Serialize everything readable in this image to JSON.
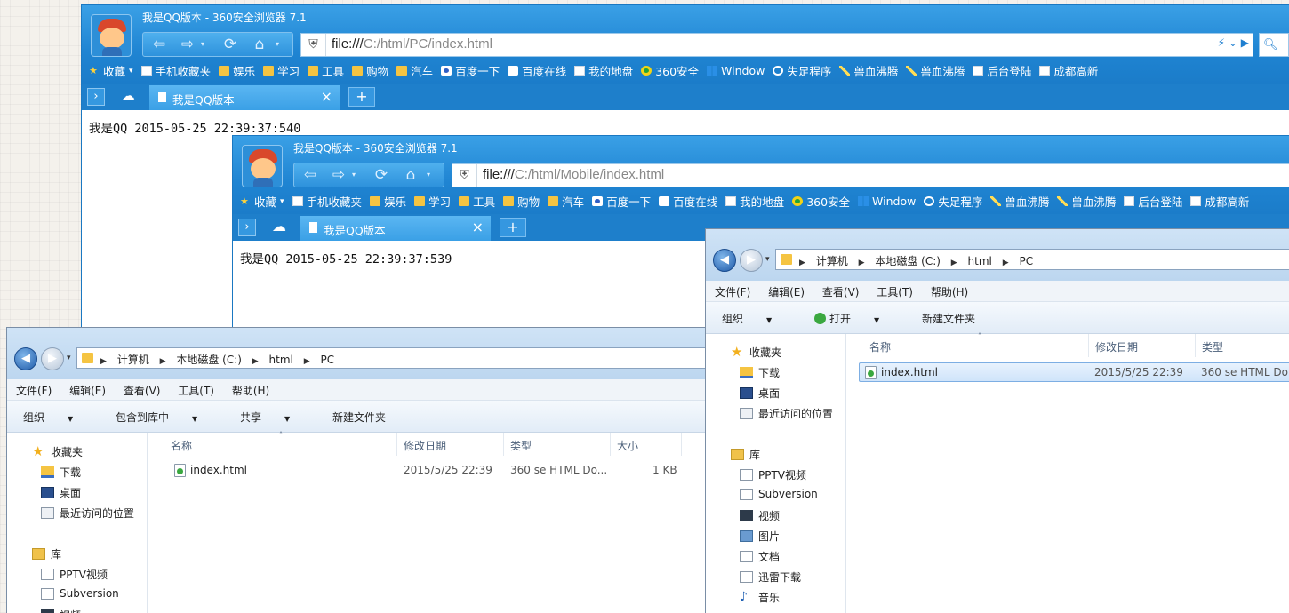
{
  "browser1": {
    "title": "我是QQ版本 - 360安全浏览器 7.1",
    "url_protocol": "file:///",
    "url_path": "C:/html/PC/index.html",
    "bookmarks": [
      "收藏",
      "手机收藏夹",
      "娱乐",
      "学习",
      "工具",
      "购物",
      "汽车",
      "百度一下",
      "百度在线",
      "我的地盘",
      "360安全",
      "Window",
      "失足程序",
      "兽血沸腾",
      "兽血沸腾",
      "后台登陆",
      "成都高新"
    ],
    "tab_title": "我是QQ版本",
    "content": "我是QQ 2015-05-25 22:39:37:540"
  },
  "browser2": {
    "title": "我是QQ版本 - 360安全浏览器 7.1",
    "url_protocol": "file:///",
    "url_path": "C:/html/Mobile/index.html",
    "bookmarks": [
      "收藏",
      "手机收藏夹",
      "娱乐",
      "学习",
      "工具",
      "购物",
      "汽车",
      "百度一下",
      "百度在线",
      "我的地盘",
      "360安全",
      "Window",
      "失足程序",
      "兽血沸腾",
      "兽血沸腾",
      "后台登陆",
      "成都高新"
    ],
    "tab_title": "我是QQ版本",
    "content": "我是QQ 2015-05-25 22:39:37:539"
  },
  "bookmark_icons": [
    "star",
    "page",
    "folder",
    "folder",
    "folder",
    "folder",
    "folder",
    "paw",
    "square",
    "page",
    "360",
    "windows",
    "ring",
    "tool",
    "tool",
    "page",
    "page"
  ],
  "explorer1": {
    "breadcrumb": [
      "计算机",
      "本地磁盘 (C:)",
      "html",
      "PC"
    ],
    "menu": [
      "文件(F)",
      "编辑(E)",
      "查看(V)",
      "工具(T)",
      "帮助(H)"
    ],
    "commands": [
      "组织",
      "包含到库中",
      "共享",
      "新建文件夹"
    ],
    "nav": {
      "favorites": "收藏夹",
      "downloads": "下载",
      "desktop": "桌面",
      "recent": "最近访问的位置",
      "libraries": "库",
      "pptv": "PPTV视频",
      "subversion": "Subversion",
      "video": "视频"
    },
    "columns": [
      "名称",
      "修改日期",
      "类型",
      "大小"
    ],
    "files": [
      {
        "name": "index.html",
        "date": "2015/5/25 22:39",
        "type": "360 se HTML Do...",
        "size": "1 KB"
      }
    ]
  },
  "explorer2": {
    "breadcrumb": [
      "计算机",
      "本地磁盘 (C:)",
      "html",
      "PC"
    ],
    "menu": [
      "文件(F)",
      "编辑(E)",
      "查看(V)",
      "工具(T)",
      "帮助(H)"
    ],
    "commands": [
      "组织",
      "打开",
      "新建文件夹"
    ],
    "nav": {
      "favorites": "收藏夹",
      "downloads": "下载",
      "desktop": "桌面",
      "recent": "最近访问的位置",
      "libraries": "库",
      "pptv": "PPTV视频",
      "subversion": "Subversion",
      "video": "视频",
      "pictures": "图片",
      "documents": "文档",
      "thunder": "迅雷下载",
      "music": "音乐"
    },
    "columns": [
      "名称",
      "修改日期",
      "类型"
    ],
    "files": [
      {
        "name": "index.html",
        "date": "2015/5/25 22:39",
        "type": "360 se HTML Do"
      }
    ]
  }
}
